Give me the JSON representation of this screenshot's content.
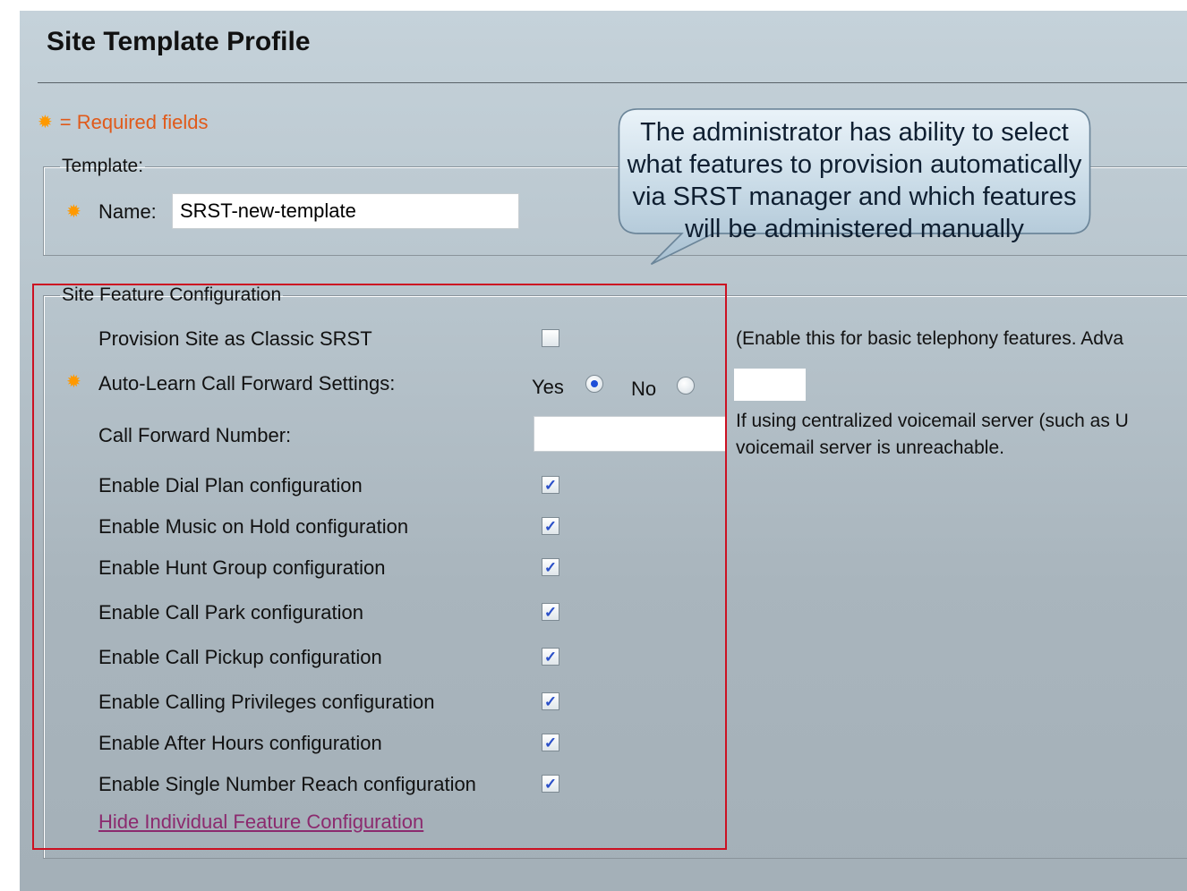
{
  "page": {
    "title": "Site Template Profile",
    "required_legend": "= Required fields"
  },
  "template": {
    "legend": "Template:",
    "name_label": "Name:",
    "name_value": "SRST-new-template"
  },
  "callout": {
    "lines": [
      "The administrator has ability to select",
      "what features to provision automatically",
      "via SRST manager and which features",
      "will be administered manually"
    ]
  },
  "features": {
    "legend": "Site Feature Configuration",
    "classic_srst": {
      "label": "Provision Site as Classic SRST",
      "checked": false,
      "help": "(Enable this for basic telephony features. Adva"
    },
    "auto_learn": {
      "label": "Auto-Learn Call Forward Settings:",
      "yes_label": "Yes",
      "no_label": "No",
      "selected": "Yes",
      "side_value": ""
    },
    "cfn": {
      "label": "Call Forward Number:",
      "value": "",
      "help_line1": "If using centralized voicemail server (such as U",
      "help_line2": "voicemail server is unreachable."
    },
    "items": [
      {
        "label": "Enable Dial Plan configuration",
        "checked": true
      },
      {
        "label": "Enable Music on Hold configuration",
        "checked": true
      },
      {
        "label": "Enable Hunt Group configuration",
        "checked": true
      },
      {
        "label": "Enable Call Park configuration",
        "checked": true
      },
      {
        "label": "Enable Call Pickup configuration",
        "checked": true
      },
      {
        "label": "Enable Calling Privileges configuration",
        "checked": true
      },
      {
        "label": "Enable After Hours configuration",
        "checked": true
      },
      {
        "label": "Enable Single Number Reach configuration",
        "checked": true
      }
    ],
    "hide_link": "Hide Individual Feature Configuration"
  },
  "icons": {
    "required": "gear-icon",
    "checkbox_mark": "checkmark-icon"
  },
  "colors": {
    "required_text": "#e05a1a",
    "required_icon": "#ff9900",
    "highlight_border": "#cc1122",
    "link": "#8b2a6e",
    "radio_selected": "#1e4fd8"
  }
}
